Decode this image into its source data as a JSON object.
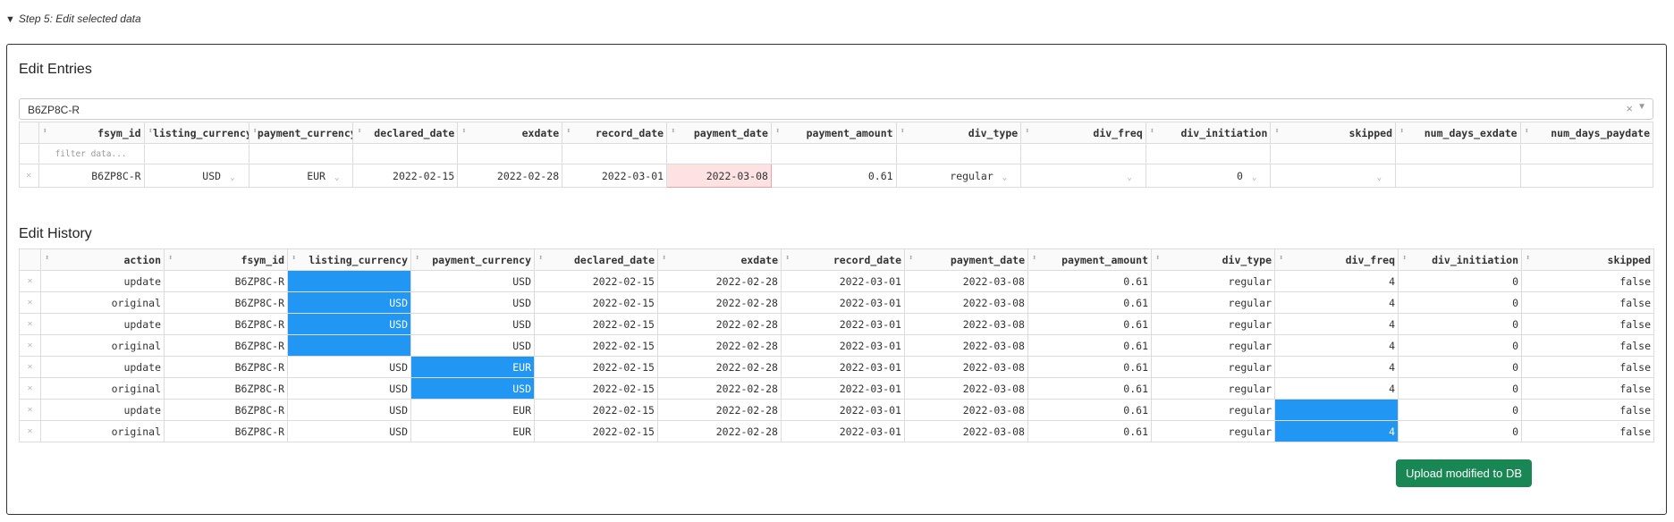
{
  "step": {
    "label": "Step 5: Edit selected data"
  },
  "entries": {
    "title": "Edit Entries",
    "selected_value": "B6ZP8C-R",
    "columns": [
      "fsym_id",
      "listing_currency",
      "payment_currency",
      "declared_date",
      "exdate",
      "record_date",
      "payment_date",
      "payment_amount",
      "div_type",
      "div_freq",
      "div_initiation",
      "skipped",
      "num_days_exdate",
      "num_days_paydate"
    ],
    "filter_placeholder": "filter data...",
    "row": [
      "B6ZP8C-R",
      "USD",
      "EUR",
      "2022-02-15",
      "2022-02-28",
      "2022-03-01",
      "2022-03-08",
      "0.61",
      "regular",
      "",
      "0",
      "",
      "",
      ""
    ]
  },
  "history": {
    "title": "Edit History",
    "columns": [
      "action",
      "fsym_id",
      "listing_currency",
      "payment_currency",
      "declared_date",
      "exdate",
      "record_date",
      "payment_date",
      "payment_amount",
      "div_type",
      "div_freq",
      "div_initiation",
      "skipped"
    ],
    "rows": [
      [
        "update",
        "B6ZP8C-R",
        "",
        "USD",
        "2022-02-15",
        "2022-02-28",
        "2022-03-01",
        "2022-03-08",
        "0.61",
        "regular",
        "4",
        "0",
        "false"
      ],
      [
        "original",
        "B6ZP8C-R",
        "USD",
        "USD",
        "2022-02-15",
        "2022-02-28",
        "2022-03-01",
        "2022-03-08",
        "0.61",
        "regular",
        "4",
        "0",
        "false"
      ],
      [
        "update",
        "B6ZP8C-R",
        "USD",
        "USD",
        "2022-02-15",
        "2022-02-28",
        "2022-03-01",
        "2022-03-08",
        "0.61",
        "regular",
        "4",
        "0",
        "false"
      ],
      [
        "original",
        "B6ZP8C-R",
        "",
        "USD",
        "2022-02-15",
        "2022-02-28",
        "2022-03-01",
        "2022-03-08",
        "0.61",
        "regular",
        "4",
        "0",
        "false"
      ],
      [
        "update",
        "B6ZP8C-R",
        "USD",
        "EUR",
        "2022-02-15",
        "2022-02-28",
        "2022-03-01",
        "2022-03-08",
        "0.61",
        "regular",
        "4",
        "0",
        "false"
      ],
      [
        "original",
        "B6ZP8C-R",
        "USD",
        "USD",
        "2022-02-15",
        "2022-02-28",
        "2022-03-01",
        "2022-03-08",
        "0.61",
        "regular",
        "4",
        "0",
        "false"
      ],
      [
        "update",
        "B6ZP8C-R",
        "USD",
        "EUR",
        "2022-02-15",
        "2022-02-28",
        "2022-03-01",
        "2022-03-08",
        "0.61",
        "regular",
        "",
        "0",
        "false"
      ],
      [
        "original",
        "B6ZP8C-R",
        "USD",
        "EUR",
        "2022-02-15",
        "2022-02-28",
        "2022-03-01",
        "2022-03-08",
        "0.61",
        "regular",
        "4",
        "0",
        "false"
      ]
    ]
  },
  "upload_button": "Upload modified to DB",
  "colors": {
    "highlight_blue": "#2196f3",
    "error_pink": "#fde2e4",
    "button_green": "#198754"
  }
}
